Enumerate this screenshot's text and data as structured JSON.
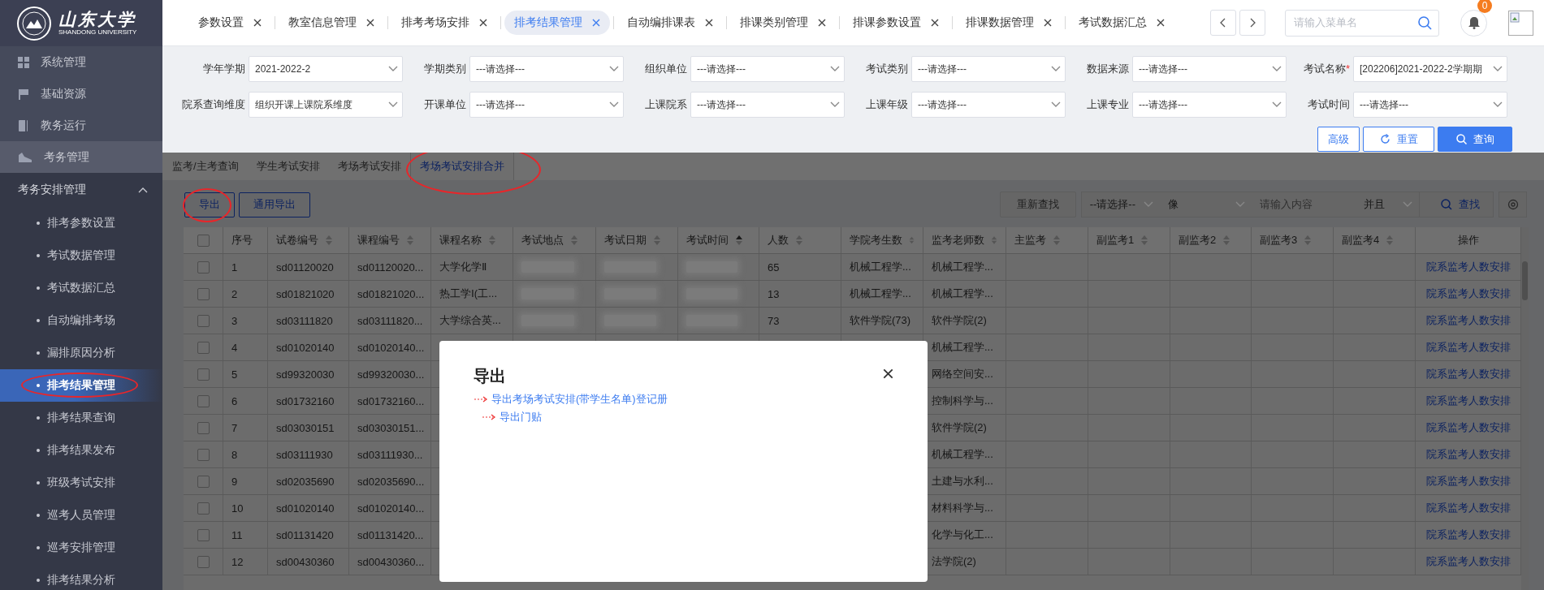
{
  "sidebar": {
    "logo": {
      "name": "山东大学",
      "subtitle": "SHANDONG UNIVERSITY"
    },
    "menu": [
      {
        "label": "系统管理",
        "selected": false
      },
      {
        "label": "基础资源",
        "selected": false
      },
      {
        "label": "教务运行",
        "selected": false
      },
      {
        "label": "考务管理",
        "selected": true
      }
    ],
    "group": {
      "label": "考务安排管理",
      "expanded": true,
      "items": [
        {
          "label": "排考参数设置",
          "selected": false,
          "circled": false
        },
        {
          "label": "考试数据管理",
          "selected": false,
          "circled": false
        },
        {
          "label": "考试数据汇总",
          "selected": false,
          "circled": false
        },
        {
          "label": "自动编排考场",
          "selected": false,
          "circled": false
        },
        {
          "label": "漏排原因分析",
          "selected": false,
          "circled": false
        },
        {
          "label": "排考结果管理",
          "selected": true,
          "circled": true
        },
        {
          "label": "排考结果查询",
          "selected": false,
          "circled": false
        },
        {
          "label": "排考结果发布",
          "selected": false,
          "circled": false
        },
        {
          "label": "班级考试安排",
          "selected": false,
          "circled": false
        },
        {
          "label": "巡考人员管理",
          "selected": false,
          "circled": false
        },
        {
          "label": "巡考安排管理",
          "selected": false,
          "circled": false
        },
        {
          "label": "排考结果分析",
          "selected": false,
          "circled": false
        }
      ]
    }
  },
  "tabs": [
    {
      "label": "参数设置",
      "selected": false
    },
    {
      "label": "教室信息管理",
      "selected": false
    },
    {
      "label": "排考考场安排",
      "selected": false
    },
    {
      "label": "排考结果管理",
      "selected": true
    },
    {
      "label": "自动编排课表",
      "selected": false
    },
    {
      "label": "排课类别管理",
      "selected": false
    },
    {
      "label": "排课参数设置",
      "selected": false
    },
    {
      "label": "排课数据管理",
      "selected": false
    },
    {
      "label": "考试数据汇总",
      "selected": false
    }
  ],
  "menu_search": {
    "placeholder": "请输入菜单名"
  },
  "notifications": {
    "count": "0"
  },
  "filters": [
    {
      "label": "学年学期",
      "value": "2021-2022-2"
    },
    {
      "label": "学期类别",
      "value": "---请选择---"
    },
    {
      "label": "组织单位",
      "value": "---请选择---"
    },
    {
      "label": "考试类别",
      "value": "---请选择---"
    },
    {
      "label": "数据来源",
      "value": "---请选择---"
    },
    {
      "label": "考试名称",
      "required_mark": "*",
      "value": "[202206]2021-2022-2学期期"
    },
    {
      "label": "院系查询维度",
      "value": "组织开课上课院系维度"
    },
    {
      "label": "开课单位",
      "value": "---请选择---"
    },
    {
      "label": "上课院系",
      "value": "---请选择---"
    },
    {
      "label": "上课年级",
      "value": "---请选择---"
    },
    {
      "label": "上课专业",
      "value": "---请选择---"
    },
    {
      "label": "考试时间",
      "value": "---请选择---"
    }
  ],
  "filter_buttons": [
    {
      "label": "高级",
      "kind": "outline"
    },
    {
      "label": "重置",
      "kind": "reset"
    },
    {
      "label": "查询",
      "kind": "primary"
    }
  ],
  "subtabs": [
    {
      "label": "监考/主考查询",
      "selected": false,
      "circled": false
    },
    {
      "label": "学生考试安排",
      "selected": false,
      "circled": false
    },
    {
      "label": "考场考试安排",
      "selected": false,
      "circled": false
    },
    {
      "label": "考场考试安排合并",
      "selected": true,
      "circled": true
    }
  ],
  "toolbar": {
    "buttons": [
      {
        "label": "导出",
        "circled": true
      },
      {
        "label": "通用导出",
        "circled": false
      }
    ],
    "refind": "重新查找",
    "field_select": "--请选择--",
    "operator": "像",
    "query_placeholder": "请输入内容",
    "logic": "并且",
    "search_button": "查找"
  },
  "table": {
    "columns": [
      {
        "kind": "checkbox",
        "checked": false
      },
      {
        "label": "序号",
        "sortable": false
      },
      {
        "label": "试卷编号",
        "sortable": true,
        "sorted_ascending": false
      },
      {
        "label": "课程编号",
        "sortable": true,
        "sorted_ascending": false
      },
      {
        "label": "课程名称",
        "sortable": true,
        "sorted_ascending": false
      },
      {
        "label": "考试地点",
        "sortable": true,
        "sorted_ascending": false
      },
      {
        "label": "考试日期",
        "sortable": true,
        "sorted_ascending": false
      },
      {
        "label": "考试时间",
        "sortable": true,
        "sorted_ascending": true
      },
      {
        "label": "人数",
        "sortable": true,
        "sorted_ascending": false
      },
      {
        "label": "学院考生数",
        "sortable": true,
        "sorted_ascending": false
      },
      {
        "label": "监考老师数",
        "sortable": true,
        "sorted_ascending": false
      },
      {
        "label": "主监考",
        "sortable": true,
        "sorted_ascending": false
      },
      {
        "label": "副监考1",
        "sortable": true,
        "sorted_ascending": false
      },
      {
        "label": "副监考2",
        "sortable": true,
        "sorted_ascending": false
      },
      {
        "label": "副监考3",
        "sortable": true,
        "sorted_ascending": false
      },
      {
        "label": "副监考4",
        "sortable": true,
        "sorted_ascending": false
      },
      {
        "label": "操作",
        "sortable": false
      }
    ],
    "rows": [
      {
        "cells": [
          {
            "kind": "checkbox",
            "checked": false
          },
          "1",
          "sd01120020",
          "sd01120020...",
          "大学化学Ⅱ",
          {
            "kind": "redacted"
          },
          {
            "kind": "redacted"
          },
          {
            "kind": "redacted"
          },
          "65",
          "机械工程学...",
          "机械工程学...",
          null,
          null,
          null,
          null,
          null,
          "院系监考人数安排"
        ]
      },
      {
        "cells": [
          {
            "kind": "checkbox",
            "checked": false
          },
          "2",
          "sd01821020",
          "sd01821020...",
          "热工学Ⅰ(工...",
          {
            "kind": "redacted"
          },
          {
            "kind": "redacted"
          },
          {
            "kind": "redacted"
          },
          "13",
          "机械工程学...",
          "机械工程学...",
          null,
          null,
          null,
          null,
          null,
          "院系监考人数安排"
        ]
      },
      {
        "cells": [
          {
            "kind": "checkbox",
            "checked": false
          },
          "3",
          "sd03111820",
          "sd03111820...",
          "大学综合英...",
          {
            "kind": "redacted"
          },
          {
            "kind": "redacted"
          },
          {
            "kind": "redacted"
          },
          "73",
          "软件学院(73)",
          "软件学院(2)",
          null,
          null,
          null,
          null,
          null,
          "院系监考人数安排"
        ]
      },
      {
        "cells": [
          {
            "kind": "checkbox",
            "checked": false
          },
          "4",
          "sd01020140",
          "sd01020140...",
          null,
          null,
          null,
          null,
          null,
          null,
          "机械工程学...",
          null,
          null,
          null,
          null,
          null,
          "院系监考人数安排"
        ]
      },
      {
        "cells": [
          {
            "kind": "checkbox",
            "checked": false
          },
          "5",
          "sd99320030",
          "sd99320030...",
          null,
          null,
          null,
          null,
          null,
          null,
          "网络空间安...",
          null,
          null,
          null,
          null,
          null,
          "院系监考人数安排"
        ]
      },
      {
        "cells": [
          {
            "kind": "checkbox",
            "checked": false
          },
          "6",
          "sd01732160",
          "sd01732160...",
          null,
          null,
          null,
          null,
          null,
          null,
          "控制科学与...",
          null,
          null,
          null,
          null,
          null,
          "院系监考人数安排"
        ]
      },
      {
        "cells": [
          {
            "kind": "checkbox",
            "checked": false
          },
          "7",
          "sd03030151",
          "sd03030151...",
          null,
          null,
          null,
          null,
          null,
          null,
          "软件学院(2)",
          null,
          null,
          null,
          null,
          null,
          "院系监考人数安排"
        ]
      },
      {
        "cells": [
          {
            "kind": "checkbox",
            "checked": false
          },
          "8",
          "sd03111930",
          "sd03111930...",
          null,
          null,
          null,
          null,
          null,
          null,
          "机械工程学...",
          null,
          null,
          null,
          null,
          null,
          "院系监考人数安排"
        ]
      },
      {
        "cells": [
          {
            "kind": "checkbox",
            "checked": false
          },
          "9",
          "sd02035690",
          "sd02035690...",
          null,
          null,
          null,
          null,
          null,
          null,
          "土建与水利...",
          null,
          null,
          null,
          null,
          null,
          "院系监考人数安排"
        ]
      },
      {
        "cells": [
          {
            "kind": "checkbox",
            "checked": false
          },
          "10",
          "sd01020140",
          "sd01020140...",
          null,
          null,
          null,
          null,
          null,
          null,
          "材料科学与...",
          null,
          null,
          null,
          null,
          null,
          "院系监考人数安排"
        ]
      },
      {
        "cells": [
          {
            "kind": "checkbox",
            "checked": false
          },
          "11",
          "sd01131420",
          "sd01131420...",
          null,
          null,
          null,
          null,
          null,
          null,
          "化学与化工...",
          null,
          null,
          null,
          null,
          null,
          "院系监考人数安排"
        ]
      },
      {
        "cells": [
          {
            "kind": "checkbox",
            "checked": false
          },
          "12",
          "sd00430360",
          "sd00430360...",
          null,
          null,
          null,
          null,
          null,
          null,
          "法学院(2)",
          null,
          null,
          null,
          null,
          null,
          "院系监考人数安排"
        ]
      }
    ]
  },
  "modal": {
    "title": "导出",
    "links": [
      {
        "label": "导出考场考试安排(带学生名单)登记册",
        "children": [
          {
            "label": "导出门贴"
          }
        ]
      }
    ]
  }
}
